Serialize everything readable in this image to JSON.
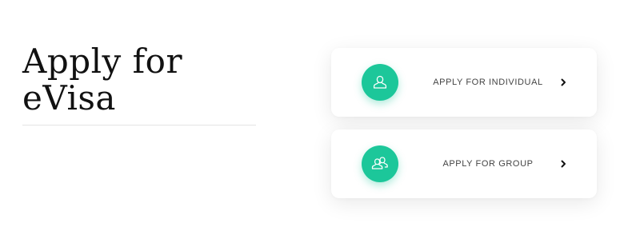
{
  "heading": {
    "line1": "Apply for",
    "line2": "eVisa"
  },
  "options": {
    "individual": {
      "label": "APPLY FOR INDIVIDUAL",
      "icon": "person-icon"
    },
    "group": {
      "label": "APPLY FOR GROUP",
      "icon": "group-icon"
    }
  },
  "colors": {
    "accent": "#1cc79a",
    "title": "#111111",
    "label": "#444444"
  }
}
